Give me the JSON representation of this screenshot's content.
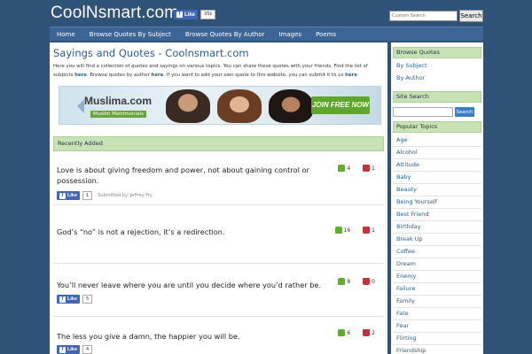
{
  "header": {
    "logo_text": "CoolNsmart.com",
    "fb_like_label": "Like",
    "fb_like_count": "35k",
    "search_placeholder": "Custom Search",
    "search_button": "Search"
  },
  "nav": {
    "items": [
      "Home",
      "Browse Quotes By Subject",
      "Browse Quotes By Author",
      "Images",
      "Poems"
    ]
  },
  "main": {
    "title": "Sayings and Quotes - Coolnsmart.com",
    "intro_part1": "Here you will find a collection of quotes and sayings on various topics. You can share these quotes with your friends. Find the list of subjects ",
    "intro_link1": "here",
    "intro_part2": ". Browse quotes by author ",
    "intro_link2": "here",
    "intro_part3": ". If you want to add your own quote to this website, you can submit it to us ",
    "intro_link3": "here",
    "intro_part4": ".",
    "ad": {
      "brand": "Muslima.com",
      "tagline": "Muslim Matrimonials",
      "cta": "JOIN FREE NOW"
    },
    "section_title": "Recently Added",
    "quotes": [
      {
        "text": "Love is about giving freedom and power, not about gaining control or possession.",
        "up": "4",
        "down": "1",
        "like_label": "Like",
        "like_count": "1",
        "submitted": "Submitted by: Jeffrey Fry"
      },
      {
        "text": "God’s “no” is not a rejection, it’s a redirection.",
        "up": "16",
        "down": "1"
      },
      {
        "text": "You’ll never leave where you are until you decide where you’d rather be.",
        "up": "8",
        "down": "0",
        "like_label": "Like",
        "like_count": "5"
      },
      {
        "text": "The less you give a damn, the happier you will be.",
        "up": "6",
        "down": "2",
        "like_label": "Like",
        "like_count": "4"
      }
    ]
  },
  "sidebar": {
    "browse_title": "Browse Quotes",
    "browse_items": [
      "By Subject",
      "By Author"
    ],
    "search_title": "Site Search",
    "search_button": "Search",
    "topics_title": "Popular Topics",
    "topics": [
      "Age",
      "Alcohol",
      "Attitude",
      "Baby",
      "Beauty",
      "Being Yourself",
      "Best Friend",
      "Birthday",
      "Break Up",
      "Coffee",
      "Dream",
      "Enemy",
      "Failure",
      "Family",
      "Fate",
      "Fear",
      "Flirting",
      "Friendship"
    ]
  }
}
